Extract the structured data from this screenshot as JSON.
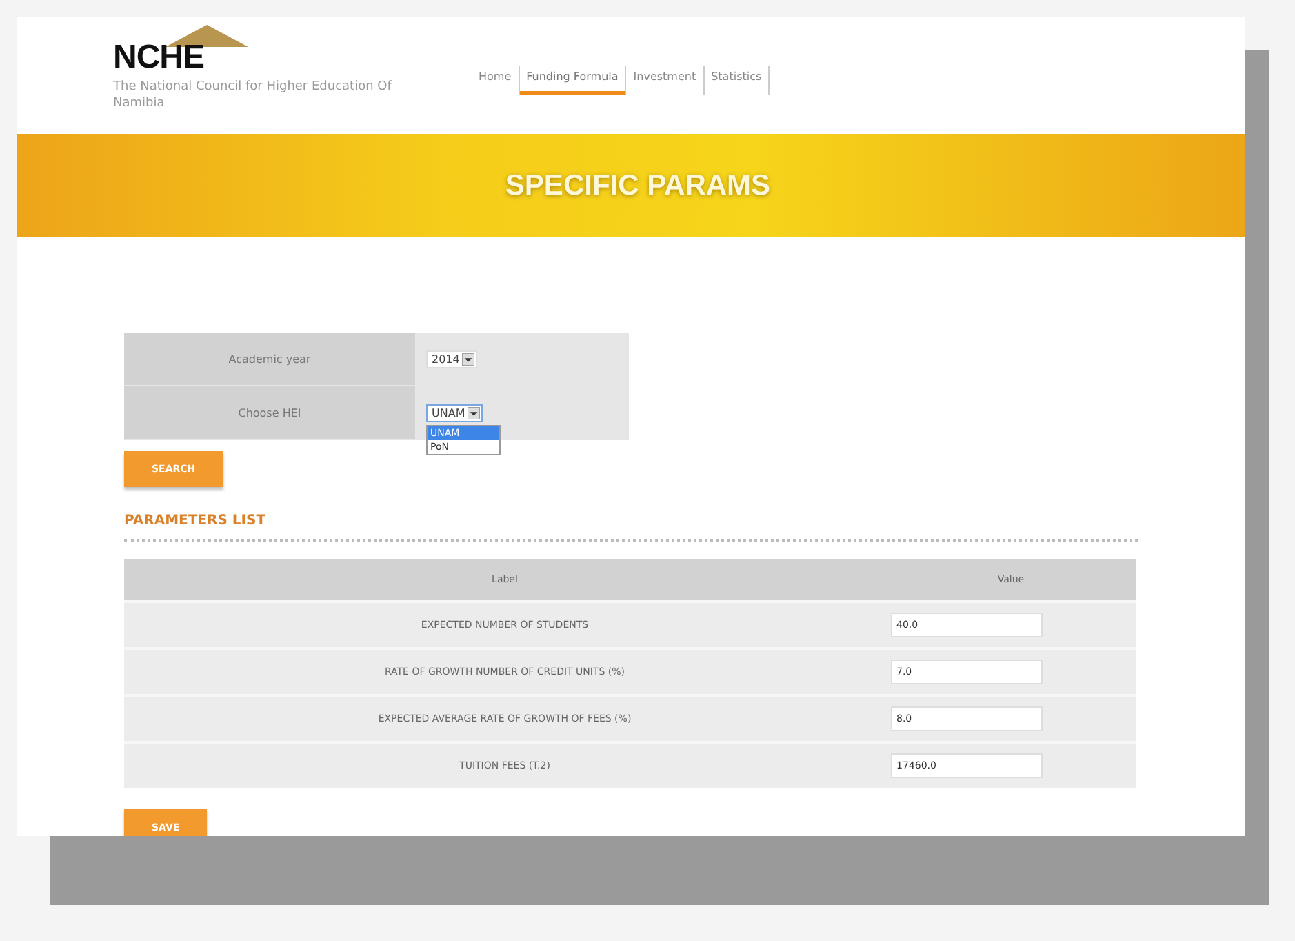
{
  "header": {
    "logo": "NCHE",
    "tagline": "The National Council for Higher Education Of Namibia"
  },
  "nav": [
    {
      "label": "Home",
      "selected": false
    },
    {
      "label": "Funding Formula",
      "selected": true
    },
    {
      "label": "Investment",
      "selected": false
    },
    {
      "label": "Statistics",
      "selected": false
    }
  ],
  "banner": {
    "title": "SPECIFIC PARAMS"
  },
  "filters": {
    "year": {
      "label": "Academic year",
      "value": "2014"
    },
    "hei": {
      "label": "Choose HEI",
      "value": "UNAM",
      "expanded": true,
      "options": [
        {
          "label": "UNAM",
          "selected": true
        },
        {
          "label": "PoN",
          "selected": false
        }
      ]
    },
    "button": "SEARCH"
  },
  "parameters": {
    "title": "PARAMETERS LIST",
    "columns": [
      "Label",
      "Value"
    ],
    "rows": [
      {
        "label": "EXPECTED NUMBER OF STUDENTS",
        "value": "40.0"
      },
      {
        "label": "RATE OF GROWTH NUMBER OF CREDIT UNITS (%)",
        "value": "7.0"
      },
      {
        "label": "EXPECTED AVERAGE RATE OF GROWTH OF FEES (%)",
        "value": "8.0"
      },
      {
        "label": "TUITION FEES (T.2)",
        "value": "17460.0"
      }
    ],
    "button": "SAVE"
  }
}
